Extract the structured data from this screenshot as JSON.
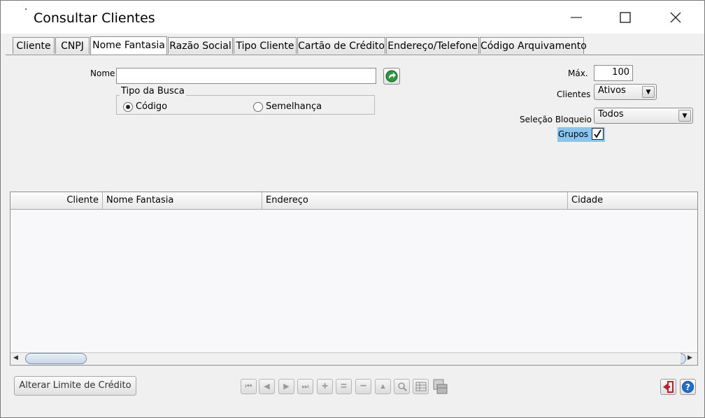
{
  "window": {
    "title": "Consultar Clientes"
  },
  "tabs": [
    {
      "label": "Cliente"
    },
    {
      "label": "CNPJ"
    },
    {
      "label": "Nome Fantasia",
      "active": true
    },
    {
      "label": "Razão Social"
    },
    {
      "label": "Tipo Cliente"
    },
    {
      "label": "Cartão de Crédito"
    },
    {
      "label": "Endereço/Telefone"
    },
    {
      "label": "Código Arquivamento"
    }
  ],
  "form": {
    "nome_label": "Nome",
    "nome_value": "",
    "tipo_busca_label": "Tipo da Busca",
    "options": [
      {
        "label": "Código",
        "selected": true
      },
      {
        "label": "Semelhança",
        "selected": false
      }
    ],
    "max_label": "Máx.",
    "max_value": "100",
    "clientes_label": "Clientes",
    "clientes_value": "Ativos",
    "selecao_label": "Seleção Bloqueio",
    "selecao_value": "Todos",
    "grupos_label": "Grupos",
    "grupos_checked": true
  },
  "grid": {
    "columns": [
      "Cliente",
      "Nome Fantasia",
      "Endereço",
      "Cidade"
    ],
    "rows": []
  },
  "footer": {
    "alterar_limite_label": "Alterar Limite de Crédito",
    "nav_buttons": [
      "first-icon",
      "prev-icon",
      "next-icon",
      "last-icon",
      "plus-icon",
      "equals-icon",
      "minus-icon",
      "up-icon",
      "search-icon",
      "grid-icon",
      "export-icon"
    ]
  },
  "colors": {
    "accent": "#1f6fd0",
    "highlight": "#87c6f3",
    "exit_red": "#c0202a"
  }
}
